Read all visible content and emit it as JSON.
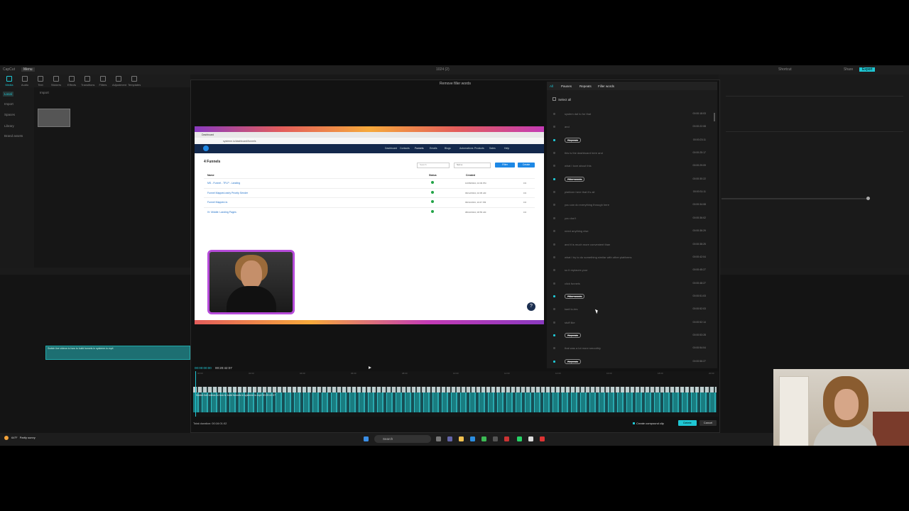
{
  "app": {
    "name": "CapCut",
    "menu_label": "Menu",
    "project_title": "1024 (2)",
    "shortcut_label": "Shortcut",
    "share_label": "Share",
    "export_label": "Export"
  },
  "toolbar": {
    "items": [
      "Media",
      "Audio",
      "Text",
      "Stickers",
      "Effects",
      "Transitions",
      "Filters",
      "Adjustment",
      "Templates"
    ]
  },
  "left_nav": {
    "items": [
      "Local",
      "Import",
      "Spaces",
      "Library",
      "Brand assets"
    ],
    "import_label": "Import"
  },
  "modal": {
    "title": "Remove filler words",
    "tabs": [
      "All",
      "Pauses",
      "Repeats",
      "Filler words"
    ],
    "select_all": "Select all",
    "transcript": [
      {
        "text": "system dal to for that",
        "time": "00:00:18:03",
        "tag": false,
        "checked": false
      },
      {
        "text": "and",
        "time": "00:00:22:08",
        "tag": false,
        "checked": false
      },
      {
        "text": "Repeats",
        "time": "00:00:23:11",
        "tag": true,
        "checked": true
      },
      {
        "text": "this is the dashboard here and",
        "time": "00:00:25:17",
        "tag": false,
        "checked": false
      },
      {
        "text": "what I love about this",
        "time": "00:00:29:09",
        "tag": false,
        "checked": false
      },
      {
        "text": "Filler words",
        "time": "00:00:30:22",
        "tag": true,
        "checked": true
      },
      {
        "text": "platform here that it's all",
        "time": "00:00:31:11",
        "tag": false,
        "checked": false
      },
      {
        "text": "you can do everything through here",
        "time": "00:00:34:08",
        "tag": false,
        "checked": false
      },
      {
        "text": "you don't",
        "time": "00:00:36:02",
        "tag": false,
        "checked": false
      },
      {
        "text": "need anything else",
        "time": "00:00:36:29",
        "tag": false,
        "checked": false
      },
      {
        "text": "and it is much more convenient than",
        "time": "00:00:38:25",
        "tag": false,
        "checked": false
      },
      {
        "text": "what I try to do something similar with other platforms",
        "time": "00:00:42:04",
        "tag": false,
        "checked": false
      },
      {
        "text": "so it replaces your",
        "time": "00:00:45:27",
        "tag": false,
        "checked": false
      },
      {
        "text": "click funnels",
        "time": "00:00:48:27",
        "tag": false,
        "checked": false
      },
      {
        "text": "Filler words",
        "time": "00:00:51:03",
        "tag": true,
        "checked": true
      },
      {
        "text": "kadi to-tes",
        "time": "00:00:52:03",
        "tag": false,
        "checked": false
      },
      {
        "text": "stuff like",
        "time": "00:00:52:14",
        "tag": false,
        "checked": false
      },
      {
        "text": "Repeats",
        "time": "00:00:53:28",
        "tag": true,
        "checked": true
      },
      {
        "text": "that was a lot more smoothly",
        "time": "00:00:54:04",
        "tag": false,
        "checked": false
      },
      {
        "text": "Repeats",
        "time": "00:00:56:27",
        "tag": true,
        "checked": true
      }
    ],
    "current_time": "00:00:00:00",
    "total_time": "00:20:42:07",
    "total_duration": "Total duration: 00:16:01:02",
    "create_compound_clip": "Create compound clip",
    "delete_label": "Delete",
    "cancel_label": "Cancel",
    "clip_label": "Switch live videos to how to build funnels in systeme.io.mp4  00:20:42:07",
    "ruler": [
      "00:00",
      "02:00",
      "04:00",
      "06:00",
      "08:00",
      "10:00",
      "12:00",
      "14:00",
      "16:00",
      "18:00",
      "20:00"
    ]
  },
  "video": {
    "tab_label": "Dashboard",
    "url": "systeme.io/dashboard/funnels",
    "nav_items": [
      "Dashboard",
      "Contacts",
      "Funnels",
      "Emails",
      "Blogs",
      "Automations",
      "Products",
      "Sales",
      "Help"
    ],
    "funnels_title": "4 Funnels",
    "search_placeholder": "Search",
    "sort_label": "Sort a",
    "filter_label": "Filter",
    "create_label": "Create",
    "col_name": "Name",
    "col_status": "Status",
    "col_created": "Created",
    "rows": [
      {
        "name": "MS - Funnel - TFLP - Landing",
        "created": "10/08/2024, 04:39 PM"
      },
      {
        "name": "Funnel Mapped-early Priority Sender",
        "created": "09/12/2024, 02:05 AM"
      },
      {
        "name": "Funnel Mapped-Is",
        "created": "09/11/2024, 10:47 PM"
      },
      {
        "name": "IV: Middle: Landing Pages",
        "created": "08/22/2024, 08:55 AM"
      }
    ],
    "help_label": "?"
  },
  "left_clip_label": "Switch live videos to how to build funnels in systeme.io.mp4",
  "taskbar": {
    "weather_temp": "64°F",
    "weather_desc": "Partly sunny",
    "search_label": "Search"
  }
}
